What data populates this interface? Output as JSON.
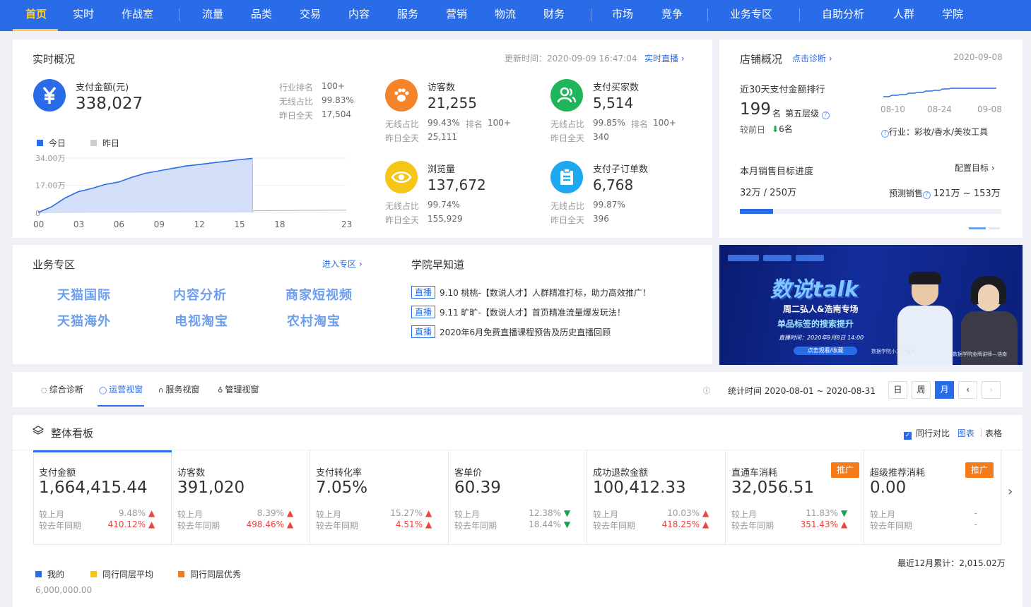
{
  "nav": {
    "items": [
      {
        "label": "首页",
        "active": true
      },
      {
        "label": "实时"
      },
      {
        "label": "作战室",
        "dot": true
      },
      {
        "label": "流量"
      },
      {
        "label": "品类"
      },
      {
        "label": "交易"
      },
      {
        "label": "内容"
      },
      {
        "label": "服务"
      },
      {
        "label": "营销"
      },
      {
        "label": "物流"
      },
      {
        "label": "财务"
      },
      {
        "label": "市场"
      },
      {
        "label": "竞争"
      },
      {
        "label": "业务专区"
      },
      {
        "label": "自助分析"
      },
      {
        "label": "人群",
        "dot": true
      },
      {
        "label": "学院"
      }
    ]
  },
  "realtime": {
    "title": "实时概况",
    "update_label": "更新时间：",
    "update_time": "2020-09-09 16:47:04",
    "live_link": "实时直播",
    "pay": {
      "label": "支付金额(元)",
      "value": "338,027",
      "rank_label": "行业排名",
      "rank_value": "100+",
      "wireless_label": "无线占比",
      "wireless_value": "99.83%",
      "yesterday_label": "昨日全天",
      "yesterday_value": "17,504"
    },
    "legend": {
      "today": "今日",
      "yesterday": "昨日"
    },
    "chart_data": {
      "type": "area",
      "x_ticks": [
        "00",
        "03",
        "06",
        "09",
        "12",
        "15",
        "18",
        "23"
      ],
      "y_ticks": [
        "34.00万",
        "17.00万",
        "0"
      ],
      "ylim": [
        0,
        340000
      ],
      "series": [
        {
          "name": "今日",
          "x": [
            0,
            1,
            2,
            3,
            4,
            5,
            6,
            7,
            8,
            9,
            10,
            11,
            12,
            13,
            14,
            15,
            16
          ],
          "values": [
            0,
            35000,
            90000,
            130000,
            150000,
            175000,
            190000,
            220000,
            245000,
            260000,
            275000,
            290000,
            300000,
            310000,
            320000,
            330000,
            338027
          ]
        },
        {
          "name": "昨日",
          "x": [
            0,
            23
          ],
          "values": [
            0,
            15000
          ]
        }
      ]
    },
    "metrics": [
      {
        "label": "访客数",
        "value": "21,255",
        "l1": "无线占比",
        "v1": "99.43%",
        "l2": "排名",
        "v2": "100+",
        "l3": "昨日全天",
        "v3": "25,111",
        "color": "#f5832a",
        "icon": "paw-icon"
      },
      {
        "label": "支付买家数",
        "value": "5,514",
        "l1": "无线占比",
        "v1": "99.85%",
        "l2": "排名",
        "v2": "100+",
        "l3": "昨日全天",
        "v3": "340",
        "color": "#1fb55a",
        "icon": "users-icon"
      },
      {
        "label": "浏览量",
        "value": "137,672",
        "l1": "无线占比",
        "v1": "99.74%",
        "l2": "",
        "v2": "",
        "l3": "昨日全天",
        "v3": "155,929",
        "color": "#f5c518",
        "icon": "eye-icon"
      },
      {
        "label": "支付子订单数",
        "value": "6,768",
        "l1": "无线占比",
        "v1": "99.87%",
        "l2": "",
        "v2": "",
        "l3": "昨日全天",
        "v3": "396",
        "color": "#1ea8f0",
        "icon": "clipboard-icon"
      }
    ]
  },
  "shop": {
    "title": "店铺概况",
    "diag_link": "点击诊断",
    "date": "2020-09-08",
    "rank_title": "近30天支付金额排行",
    "rank_value": "199",
    "rank_unit": "名",
    "tier": "第五层级",
    "compare_label": "较前日",
    "compare_value": "6名",
    "spark_ticks": [
      "08-10",
      "08-24",
      "09-08"
    ],
    "industry": "行业：彩妆/香水/美妆工具",
    "target_title": "本月销售目标进度",
    "config_target": "配置目标",
    "progress_text": "32万 / 250万",
    "progress_ratio": 0.128,
    "forecast_label": "预测销售",
    "forecast_value": "121万 ~ 153万"
  },
  "biz": {
    "title": "业务专区",
    "enter_link": "进入专区",
    "items": [
      "天猫国际",
      "内容分析",
      "商家短视频",
      "天猫海外",
      "电视淘宝",
      "农村淘宝"
    ]
  },
  "academy": {
    "title": "学院早知道",
    "tag": "直播",
    "items": [
      "9.10 桃桃-【数说人才】人群精准打标，助力高效推广！",
      "9.11 旷旷-【数说人才】首页精准流量爆发玩法！",
      "2020年6月免费直播课程预告及历史直播回顾"
    ]
  },
  "banner": {
    "headline": "数说talk",
    "line1": "周二弘人&浩南专场",
    "line2": "单品标签的搜索提升",
    "time": "直播时间：2020年9月8日 14:00",
    "button": "点击观看/收藏",
    "speaker1": "数据学院小二一弘人",
    "speaker2": "数据学院金牌讲师—浩南"
  },
  "tabs": {
    "items": [
      {
        "label": "综合诊断",
        "icon": "diagnosis-icon"
      },
      {
        "label": "运营视窗",
        "icon": "operation-icon",
        "active": true
      },
      {
        "label": "服务视窗",
        "icon": "headset-icon"
      },
      {
        "label": "管理视窗",
        "icon": "manage-icon"
      }
    ],
    "stat_label": "统计时间",
    "stat_range": "2020-08-01 ~ 2020-08-31",
    "period_buttons": [
      "日",
      "周",
      "月"
    ],
    "period_active": "月"
  },
  "board": {
    "title": "整体看板",
    "peer_compare": "同行对比",
    "view_chart": "图表",
    "view_table": "表格",
    "kpis": [
      {
        "label": "支付金额",
        "value": "1,664,415.44",
        "l1": "较上月",
        "v1": "9.48%",
        "d1": "up",
        "l2": "较去年同期",
        "v2": "410.12%",
        "d2": "up",
        "badge": ""
      },
      {
        "label": "访客数",
        "value": "391,020",
        "l1": "较上月",
        "v1": "8.39%",
        "d1": "up",
        "l2": "较去年同期",
        "v2": "498.46%",
        "d2": "up",
        "badge": ""
      },
      {
        "label": "支付转化率",
        "value": "7.05%",
        "l1": "较上月",
        "v1": "15.27%",
        "d1": "up",
        "l2": "较去年同期",
        "v2": "4.51%",
        "d2": "up",
        "badge": ""
      },
      {
        "label": "客单价",
        "value": "60.39",
        "l1": "较上月",
        "v1": "12.38%",
        "d1": "down",
        "l2": "较去年同期",
        "v2": "18.44%",
        "d2": "down",
        "badge": ""
      },
      {
        "label": "成功退款金额",
        "value": "100,412.33",
        "l1": "较上月",
        "v1": "10.03%",
        "d1": "up",
        "l2": "较去年同期",
        "v2": "418.25%",
        "d2": "up",
        "badge": ""
      },
      {
        "label": "直通车消耗",
        "value": "32,056.51",
        "l1": "较上月",
        "v1": "11.83%",
        "d1": "down",
        "l2": "较去年同期",
        "v2": "351.43%",
        "d2": "up",
        "badge": "推广"
      },
      {
        "label": "超级推荐消耗",
        "value": "0.00",
        "l1": "较上月",
        "v1": "-",
        "d1": "",
        "l2": "较去年同期",
        "v2": "-",
        "d2": "",
        "badge": "推广"
      }
    ],
    "legend": [
      "我的",
      "同行同层平均",
      "同行同层优秀"
    ],
    "legend_colors": [
      "#2a6be8",
      "#f5c518",
      "#f57a1a"
    ],
    "total_label": "最近12月累计：",
    "total_value": "2,015.02万",
    "y_top": "6,000,000.00"
  },
  "colors": {
    "primary": "#2a6be8",
    "up": "#e8433e",
    "down": "#15a34a"
  }
}
